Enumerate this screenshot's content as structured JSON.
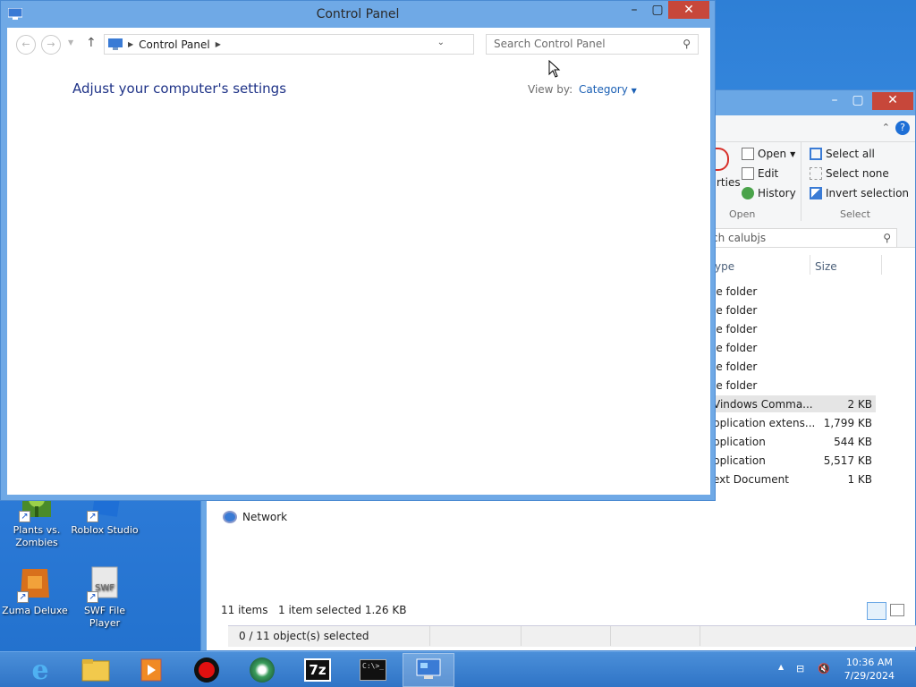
{
  "control_panel": {
    "title": "Control Panel",
    "breadcrumb": "Control Panel",
    "search_placeholder": "Search Control Panel",
    "heading": "Adjust your computer's settings",
    "view_by_label": "View by:",
    "view_by_value": "Category"
  },
  "explorer": {
    "search_text": "ch calubjs",
    "ribbon": {
      "properties_partial": "rties",
      "open": "Open",
      "edit": "Edit",
      "history": "History",
      "open_group": "Open",
      "select_all": "Select all",
      "select_none": "Select none",
      "invert_selection": "Invert selection",
      "select_group": "Select"
    },
    "columns": {
      "type": "ype",
      "size": "Size"
    },
    "rows": [
      {
        "type": "le folder",
        "size": ""
      },
      {
        "type": "le folder",
        "size": ""
      },
      {
        "type": "le folder",
        "size": ""
      },
      {
        "type": "le folder",
        "size": ""
      },
      {
        "type": "le folder",
        "size": ""
      },
      {
        "type": "le folder",
        "size": ""
      },
      {
        "type": "Vindows Comma...",
        "size": "2 KB"
      },
      {
        "type": "pplication extens...",
        "size": "1,799 KB"
      },
      {
        "type": "pplication",
        "size": "544 KB"
      },
      {
        "type": "pplication",
        "size": "5,517 KB"
      },
      {
        "type": "ext Document",
        "size": "1 KB"
      }
    ],
    "network": "Network",
    "status_items": "11 items",
    "status_selected": "1 item selected  1.26 KB",
    "bottom_status": "0 / 11 object(s) selected"
  },
  "desktop_icons": [
    {
      "label": "Plants vs. Zombies"
    },
    {
      "label": "Roblox Studio"
    },
    {
      "label": "Zuma Deluxe"
    },
    {
      "label": "SWF File Player"
    }
  ],
  "taskbar": {
    "time": "10:36 AM",
    "date": "7/29/2024",
    "sevenzip": "7z",
    "cmd": "C:\\>_"
  },
  "colors": {
    "accent": "#1a5fb4",
    "close": "#c7473a",
    "desktop": "#2e7fd6"
  }
}
